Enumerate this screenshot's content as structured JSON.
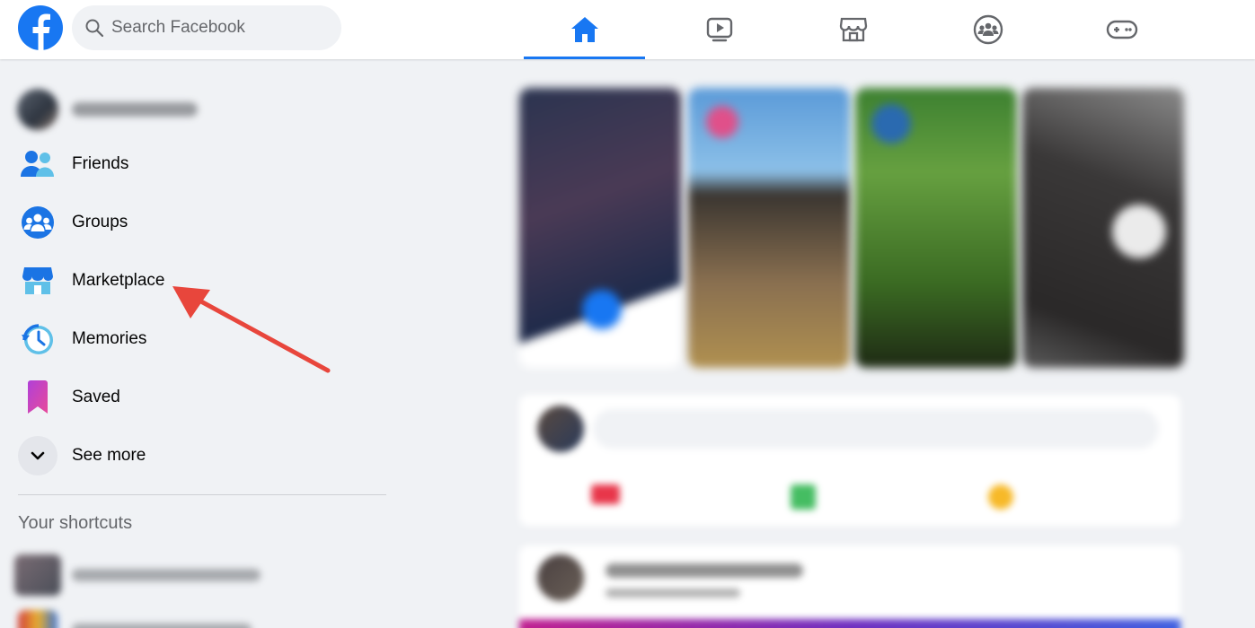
{
  "header": {
    "search_placeholder": "Search Facebook",
    "nav_tabs": [
      {
        "name": "home",
        "active": true
      },
      {
        "name": "watch",
        "active": false
      },
      {
        "name": "marketplace",
        "active": false
      },
      {
        "name": "groups",
        "active": false
      },
      {
        "name": "gaming",
        "active": false
      }
    ],
    "accent_color": "#1877f2"
  },
  "sidebar": {
    "items": [
      {
        "label": "Friends",
        "icon": "friends-icon"
      },
      {
        "label": "Groups",
        "icon": "groups-icon"
      },
      {
        "label": "Marketplace",
        "icon": "marketplace-icon"
      },
      {
        "label": "Memories",
        "icon": "memories-icon"
      },
      {
        "label": "Saved",
        "icon": "saved-icon"
      },
      {
        "label": "See more",
        "icon": "chevron-down-icon"
      }
    ],
    "shortcuts_title": "Your shortcuts"
  },
  "annotation": {
    "color": "#e8463c",
    "target": "Marketplace"
  }
}
